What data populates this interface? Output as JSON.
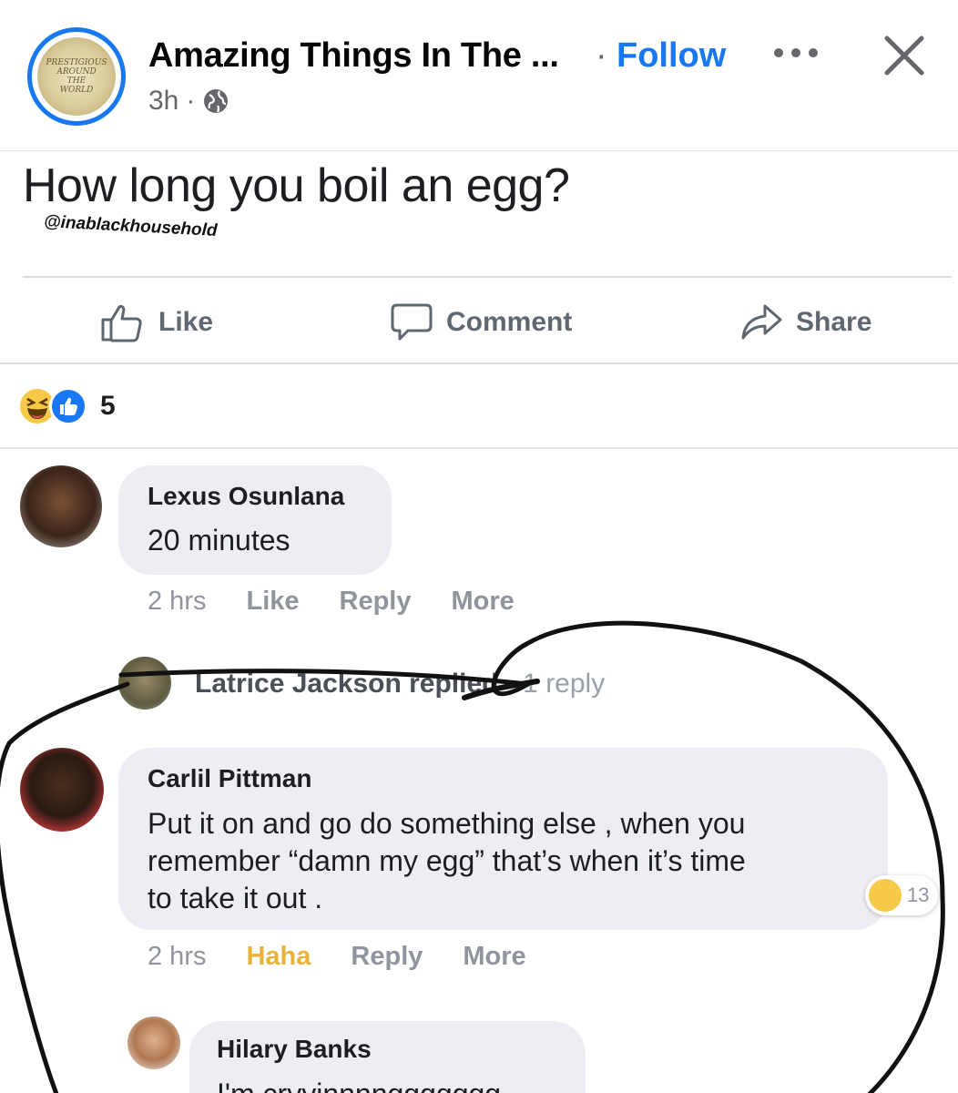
{
  "header": {
    "page_name": "Amazing Things In The ...",
    "separator": "·",
    "follow_label": "Follow",
    "age": "3h",
    "age_separator": "·",
    "avatar_text": [
      "PRESTIGIOUS",
      "AROUND",
      "THE",
      "WORLD"
    ],
    "icons": {
      "privacy": "globe-icon",
      "more": "more-options-icon",
      "close": "close-icon"
    },
    "accent_color": "#1877f2"
  },
  "post": {
    "question": "How long you boil an egg?",
    "watermark": "@inablackhousehold",
    "actions": {
      "like_label": "Like",
      "comment_label": "Comment",
      "share_label": "Share"
    },
    "reactions": {
      "icons": [
        "haha-emoji",
        "like-emoji"
      ],
      "count": "5"
    }
  },
  "comments": [
    {
      "author": "Lexus Osunlana",
      "text": "20 minutes",
      "time": "2 hrs",
      "like_label": "Like",
      "reply_label": "Reply",
      "more_label": "More"
    },
    {
      "reply_summary_author": "Latrice Jackson replied",
      "reply_summary_rest": "· 1 reply"
    },
    {
      "author": "Carlil Pittman",
      "text_lines": [
        "Put it on and go do something else , when you",
        "remember “damn my egg” that’s when it’s time",
        "to take it out ."
      ],
      "time": "2 hrs",
      "like_label": "Haha",
      "reply_label": "Reply",
      "more_label": "More",
      "reaction_count": "13"
    },
    {
      "author": "Hilary Banks",
      "text": "I'm cryyinnnnggggggg"
    }
  ]
}
